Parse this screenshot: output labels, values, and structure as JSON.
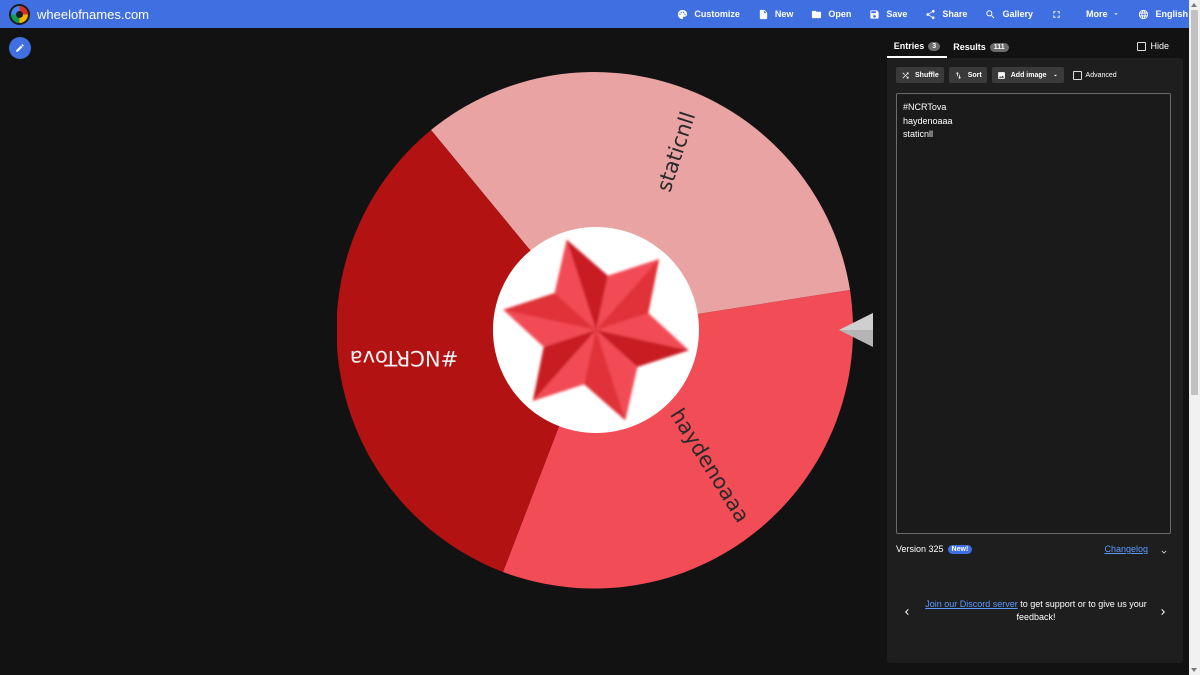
{
  "header": {
    "site_name": "wheelofnames.com",
    "menu": [
      {
        "label": "Customize",
        "icon": "palette-icon"
      },
      {
        "label": "New",
        "icon": "new-file-icon"
      },
      {
        "label": "Open",
        "icon": "folder-icon"
      },
      {
        "label": "Save",
        "icon": "save-icon"
      },
      {
        "label": "Share",
        "icon": "share-icon"
      },
      {
        "label": "Gallery",
        "icon": "search-icon"
      },
      {
        "label": "",
        "icon": "fullscreen-icon"
      },
      {
        "label": "More",
        "icon": "chevron-down-icon"
      },
      {
        "label": "English",
        "icon": "globe-icon"
      }
    ]
  },
  "wheel": {
    "segments": [
      {
        "label": "staticnll",
        "color": "#e9a3a3"
      },
      {
        "label": "haydenoaaa",
        "color": "#f24c56"
      },
      {
        "label": "#NCRTova",
        "color": "#b31212"
      }
    ],
    "center_icon": "red-star-icon",
    "pointer_icon": "pointer-arrow-icon"
  },
  "panel": {
    "tabs": [
      {
        "label": "Entries",
        "count": "3"
      },
      {
        "label": "Results",
        "count": "111"
      }
    ],
    "hide_label": "Hide",
    "toolbar": {
      "shuffle_label": "Shuffle",
      "sort_label": "Sort",
      "add_image_label": "Add image",
      "advanced_label": "Advanced"
    },
    "entries": [
      "#NCRTova",
      "haydenoaaa",
      "staticnll"
    ],
    "version": "Version 325",
    "new_badge": "New!",
    "changelog_label": "Changelog",
    "discord": {
      "link_text": "Join our Discord server",
      "rest_text": " to get support or to give us your feedback!"
    }
  },
  "colors": {
    "accent": "#3f6fe0",
    "background": "#121212",
    "panel": "#1e1e1e"
  }
}
